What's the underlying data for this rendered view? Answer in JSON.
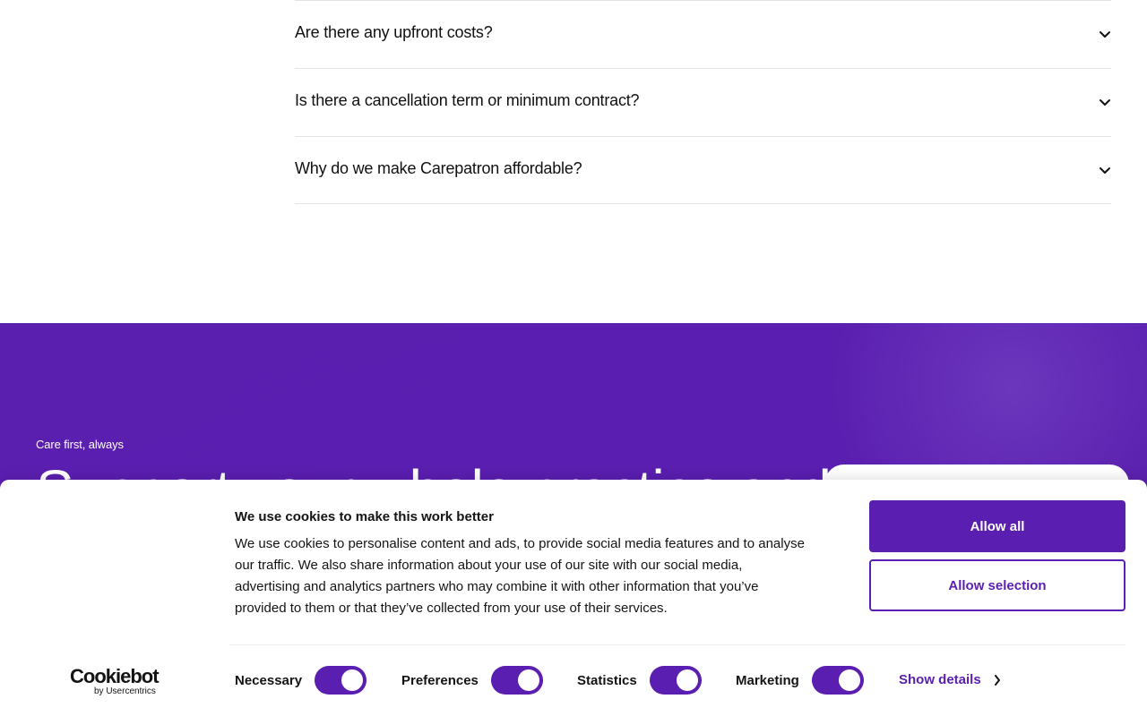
{
  "faq": {
    "items": [
      {
        "question": "Are there any upfront costs?",
        "icon": "chevron-down-icon"
      },
      {
        "question": "Is there a cancellation term or minimum contract?",
        "icon": "chevron-down-icon"
      },
      {
        "question": "Why do we make Carepatron affordable?",
        "icon": "chevron-down-icon"
      }
    ]
  },
  "cta_section": {
    "tagline": "Care first, always",
    "headline": "Support your whole practice and",
    "background_color": "#5a1eb0"
  },
  "cookie_banner": {
    "title": "We use cookies to make this work better",
    "body": "We use cookies to personalise content and ads, to provide social media features and to analyse our traffic. We also share information about your use of our site with our social media, advertising and analytics partners who may combine it with other information that you’ve provided to them or that they’ve collected from your use of their services.",
    "allow_all_label": "Allow all",
    "allow_selection_label": "Allow selection",
    "logo": {
      "name": "Cookiebot",
      "byline": "by Usercentrics"
    },
    "toggles": [
      {
        "label": "Necessary",
        "checked": true
      },
      {
        "label": "Preferences",
        "checked": true
      },
      {
        "label": "Statistics",
        "checked": true
      },
      {
        "label": "Marketing",
        "checked": true
      }
    ],
    "show_details_label": "Show details",
    "accent_color": "#5a1fb0"
  }
}
